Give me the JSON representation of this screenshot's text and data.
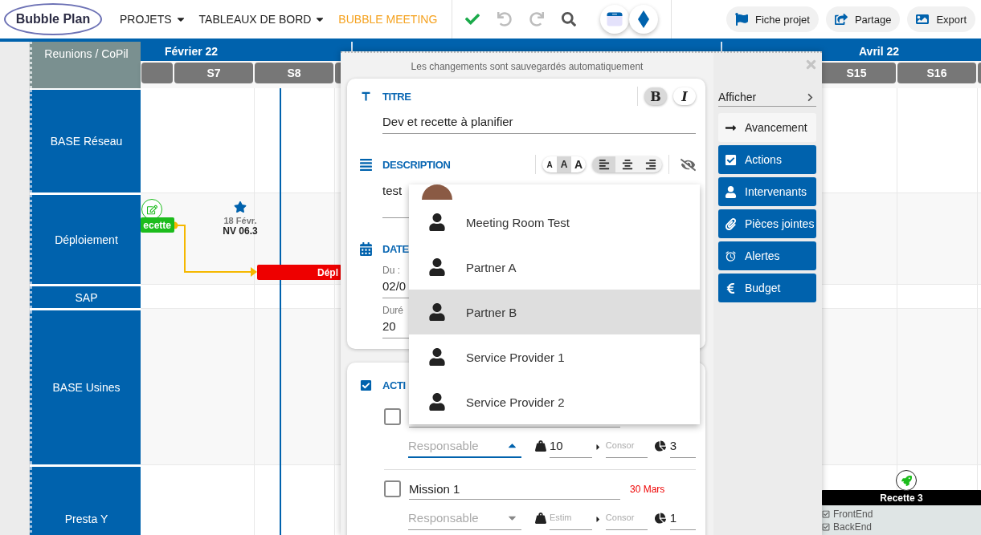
{
  "app": {
    "logo": "Bubble Plan"
  },
  "nav": [
    {
      "label": "PROJETS",
      "has_menu": true,
      "selected": false
    },
    {
      "label": "TABLEAUX DE BORD",
      "has_menu": true,
      "selected": false
    },
    {
      "label": "BUBBLE MEETING",
      "has_menu": false,
      "selected": true
    }
  ],
  "toolbar": [
    {
      "kind": "save",
      "disabled": false
    },
    {
      "kind": "undo",
      "disabled": true
    },
    {
      "kind": "redo",
      "disabled": true
    },
    {
      "kind": "search",
      "disabled": false
    }
  ],
  "views": [
    {
      "kind": "calendar"
    },
    {
      "kind": "diamond"
    }
  ],
  "actions": [
    {
      "kind": "flag",
      "label": "Fiche projet"
    },
    {
      "kind": "share",
      "label": "Partage"
    },
    {
      "kind": "image",
      "label": "Export"
    }
  ],
  "gantt": {
    "group_label": "Reunions / CoPil",
    "months": [
      {
        "label": "Février 22"
      },
      {
        "label": "Avril 22"
      }
    ],
    "weeks": [
      {
        "label": "S7"
      },
      {
        "label": "S8"
      },
      {
        "label": "S15"
      },
      {
        "label": "S16"
      }
    ],
    "rows": [
      {
        "label": "BASE Réseau"
      },
      {
        "label": "Déploiement"
      },
      {
        "label": "SAP"
      },
      {
        "label": "BASE Usines"
      },
      {
        "label": "Presta Y"
      }
    ],
    "tasks": [
      {
        "label": "ecette",
        "color": "#1cbc1c"
      },
      {
        "label": "Dépl",
        "color": "#ee0000"
      },
      {
        "label": "Recette 3",
        "color": "#000000",
        "subtasks": [
          {
            "label": "FrontEnd",
            "checked": true
          },
          {
            "label": "BackEnd",
            "checked": true
          }
        ]
      }
    ],
    "milestone": {
      "date": "18 Févr.",
      "label": "NV 06.3"
    }
  },
  "modal": {
    "notice": "Les changements sont sauvegardés automatiquement",
    "title": {
      "heading": "TITRE",
      "value": "Dev et recette à planifier",
      "bold_label": "B",
      "italic_label": "I",
      "bold": true,
      "italic": false
    },
    "description": {
      "heading": "DESCRIPTION",
      "value": "test",
      "sizes": [
        {
          "label": "A",
          "selected": false
        },
        {
          "label": "A",
          "selected": true
        },
        {
          "label": "A",
          "selected": false
        }
      ],
      "alignments": [
        {
          "kind": "left",
          "selected": true
        },
        {
          "kind": "center",
          "selected": false
        },
        {
          "kind": "right",
          "selected": false
        }
      ]
    },
    "dates": {
      "heading": "DATE",
      "from_label": "Du :",
      "from_value": "02/0",
      "duration_label": "Duré",
      "duration_value": "20"
    },
    "actions": {
      "heading": "ACTI",
      "checked": true,
      "items": [
        {
          "checked": false,
          "responsible_placeholder": "Responsable",
          "responsible_open": true,
          "estimate": "10",
          "consumed_placeholder": "Consor",
          "progress": "3"
        },
        {
          "checked": false,
          "title": "Mission 1",
          "due": "30 Mars",
          "responsible_placeholder": "Responsable",
          "responsible_open": false,
          "estimate_placeholder": "Estim",
          "consumed_placeholder": "Consor",
          "progress": "1"
        }
      ]
    },
    "dropdown": [
      {
        "kind": "avatar",
        "highlighted": false
      },
      {
        "kind": "person",
        "label": "Meeting Room Test",
        "highlighted": false
      },
      {
        "kind": "person",
        "label": "Partner A",
        "highlighted": false
      },
      {
        "kind": "person",
        "label": "Partner B",
        "highlighted": true
      },
      {
        "kind": "person",
        "label": "Service Provider 1",
        "highlighted": false
      },
      {
        "kind": "person",
        "label": "Service Provider 2",
        "highlighted": false
      }
    ],
    "side": {
      "title": "Afficher",
      "sections": [
        {
          "kind": "progress",
          "label": "Avancement",
          "active": false
        },
        {
          "kind": "actions",
          "label": "Actions",
          "active": true
        },
        {
          "kind": "people",
          "label": "Intervenants",
          "active": true
        },
        {
          "kind": "attachments",
          "label": "Pièces jointes",
          "active": true
        },
        {
          "kind": "alerts",
          "label": "Alertes",
          "active": true
        },
        {
          "kind": "budget",
          "label": "Budget",
          "active": true
        }
      ]
    }
  }
}
